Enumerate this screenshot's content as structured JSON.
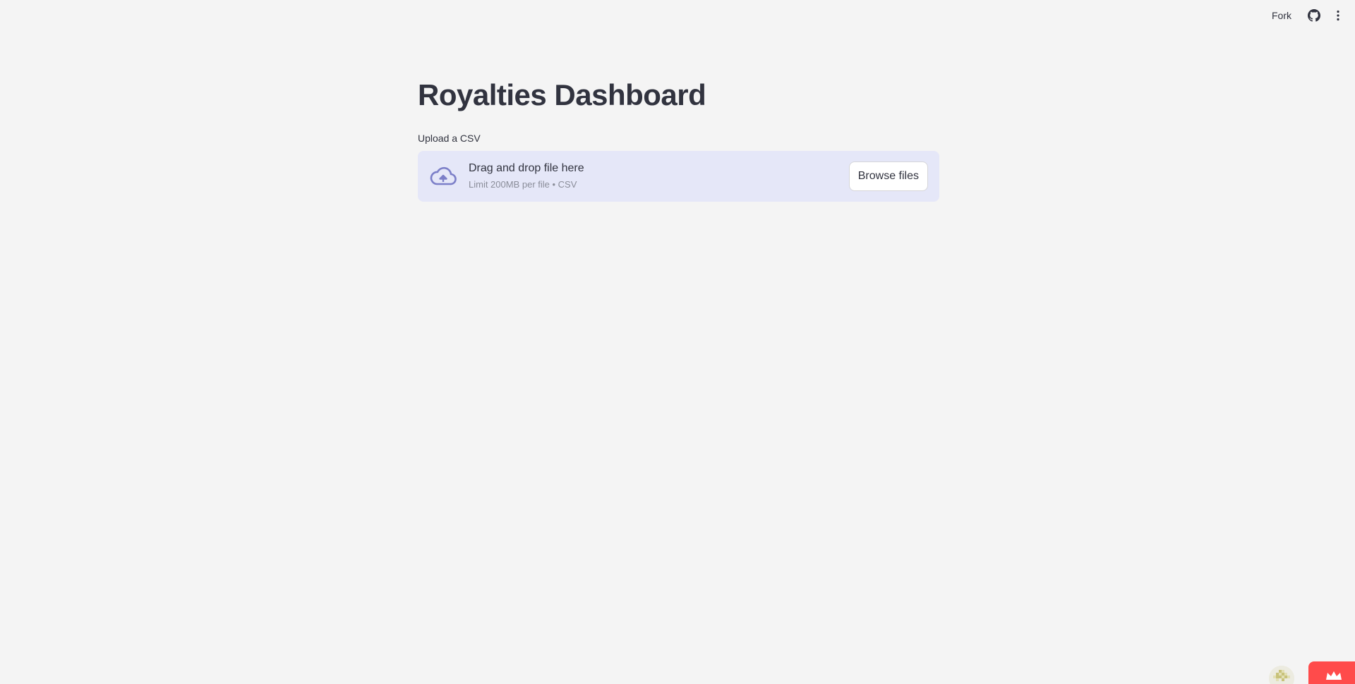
{
  "toolbar": {
    "fork_label": "Fork",
    "github_icon": "github-icon",
    "menu_icon": "kebab-menu-icon"
  },
  "main": {
    "title": "Royalties Dashboard",
    "uploader": {
      "label": "Upload a CSV",
      "drop_text": "Drag and drop file here",
      "limit_text": "Limit 200MB per file • CSV",
      "browse_label": "Browse files",
      "icon": "cloud-upload-icon"
    }
  },
  "colors": {
    "background": "#f4f4f4",
    "dropzone": "#e5e7f8",
    "accent": "#7c7fc8",
    "brand_red": "#ff4b4b",
    "text": "#31333f"
  }
}
